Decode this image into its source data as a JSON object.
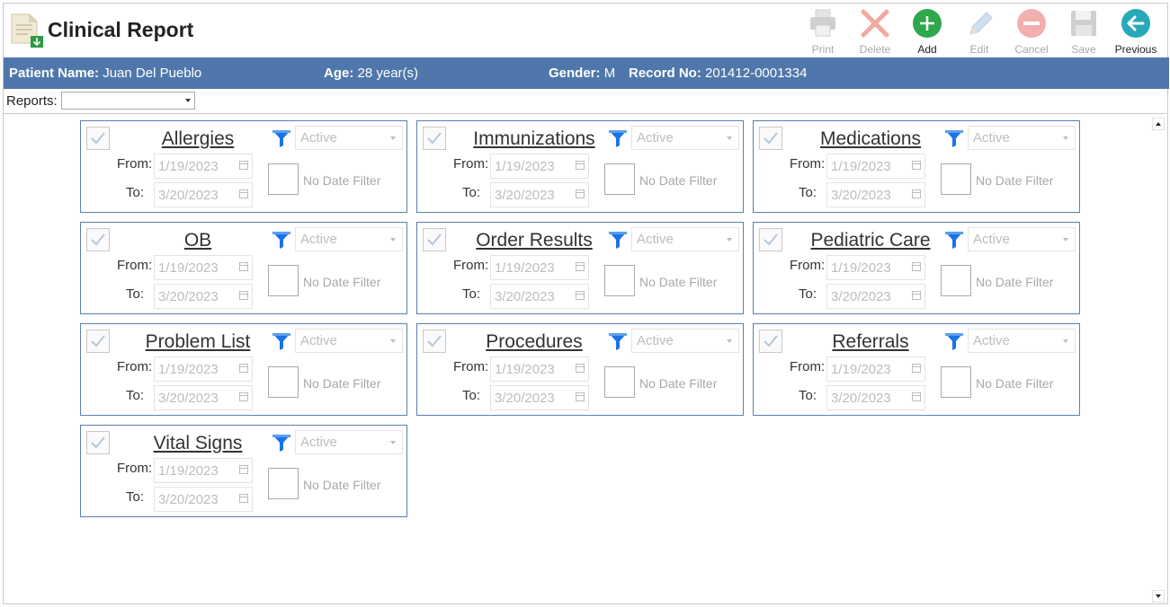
{
  "app": {
    "title": "Clinical Report"
  },
  "toolbar": [
    {
      "label": "Print",
      "icon": "printer-icon",
      "enabled": false
    },
    {
      "label": "Delete",
      "icon": "x-icon",
      "enabled": false
    },
    {
      "label": "Add",
      "icon": "plus-circle-icon",
      "enabled": true
    },
    {
      "label": "Edit",
      "icon": "pencil-icon",
      "enabled": false
    },
    {
      "label": "Cancel",
      "icon": "minus-circle-icon",
      "enabled": false
    },
    {
      "label": "Save",
      "icon": "floppy-icon",
      "enabled": false
    },
    {
      "label": "Previous",
      "icon": "arrow-left-circle-icon",
      "enabled": true
    }
  ],
  "patient": {
    "name_label": "Patient Name:",
    "name": "Juan Del Pueblo",
    "age_label": "Age:",
    "age": "28 year(s)",
    "gender_label": "Gender:",
    "gender": "M",
    "record_label": "Record No:",
    "record": "201412-0001334"
  },
  "reports": {
    "label": "Reports:",
    "value": ""
  },
  "card_labels": {
    "from": "From:",
    "to": "To:",
    "no_date_filter": "No Date Filter"
  },
  "cards": [
    {
      "title": "Allergies",
      "status": "Active",
      "from": "1/19/2023",
      "to": "3/20/2023"
    },
    {
      "title": "Immunizations",
      "status": "Active",
      "from": "1/19/2023",
      "to": "3/20/2023"
    },
    {
      "title": "Medications",
      "status": "Active",
      "from": "1/19/2023",
      "to": "3/20/2023"
    },
    {
      "title": "OB",
      "status": "Active",
      "from": "1/19/2023",
      "to": "3/20/2023"
    },
    {
      "title": "Order Results",
      "status": "Active",
      "from": "1/19/2023",
      "to": "3/20/2023"
    },
    {
      "title": "Pediatric Care",
      "status": "Active",
      "from": "1/19/2023",
      "to": "3/20/2023"
    },
    {
      "title": "Problem List",
      "status": "Active",
      "from": "1/19/2023",
      "to": "3/20/2023"
    },
    {
      "title": "Procedures",
      "status": "Active",
      "from": "1/19/2023",
      "to": "3/20/2023"
    },
    {
      "title": "Referrals",
      "status": "Active",
      "from": "1/19/2023",
      "to": "3/20/2023"
    },
    {
      "title": "Vital Signs",
      "status": "Active",
      "from": "1/19/2023",
      "to": "3/20/2023"
    }
  ],
  "colors": {
    "patient_bar": "#5077ab",
    "card_border": "#5a7fb0",
    "filter_icon": "#1a73e8",
    "add": "#2ea84a",
    "previous": "#27a9b8"
  }
}
